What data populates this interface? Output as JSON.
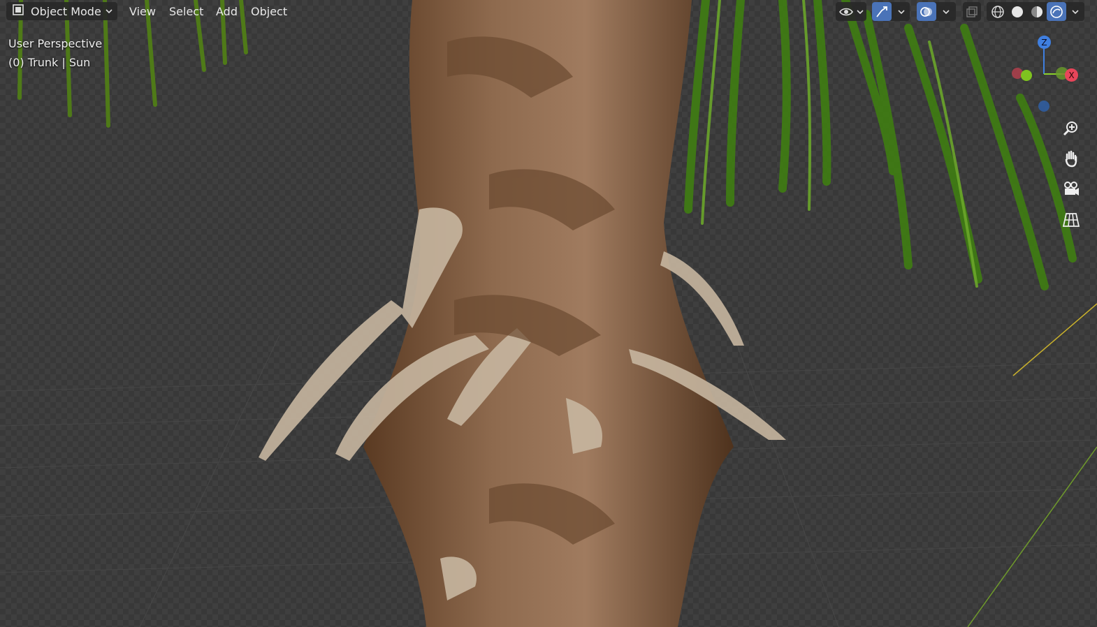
{
  "header": {
    "mode_label": "Object Mode",
    "menus": [
      "View",
      "Select",
      "Add",
      "Object"
    ]
  },
  "overlay": {
    "perspective": "User Perspective",
    "collection": "(0) Trunk | Sun"
  },
  "gizmo": {
    "axis_z": "Z",
    "axis_x": "X"
  },
  "icons": {
    "mode": "object-mode-icon",
    "visibility": "eye-icon",
    "gizmo_toggle": "gizmo-icon",
    "overlays": "overlays-icon",
    "xray": "xray-icon",
    "wireframe": "wireframe-shading-icon",
    "solid": "solid-shading-icon",
    "material": "material-preview-icon",
    "rendered": "rendered-shading-icon",
    "zoom": "zoom-icon",
    "pan": "hand-icon",
    "camera": "camera-icon",
    "ortho": "grid-perspective-icon"
  },
  "colors": {
    "active_blue": "#4a73b8",
    "axis_x": "#e8455a",
    "axis_y": "#8ad12b",
    "axis_z": "#3f7fe0"
  }
}
